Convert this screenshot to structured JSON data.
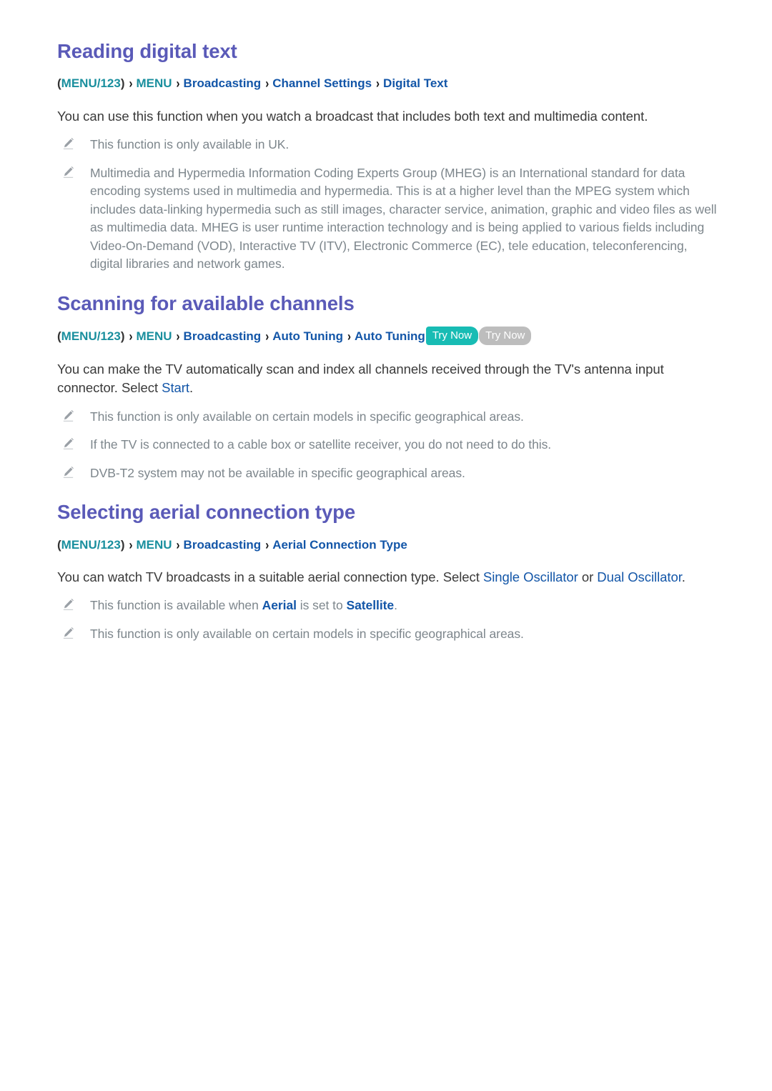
{
  "document": {
    "title": "Samsung TV e-Manual - Broadcasting",
    "colors": {
      "heading": "#5A5AB8",
      "menu_crumb": "#1A8F9E",
      "link_crumb": "#1356A8",
      "body_text": "#3A3A3A",
      "note_text": "#7D868C",
      "trynow_active": "#18BCB4",
      "trynow_inactive": "#BDBDBD"
    }
  },
  "sections": [
    {
      "id": "reading-digital-text",
      "heading": "Reading digital text",
      "breadcrumb": {
        "open_paren": "(",
        "menu123": "MENU/123",
        "close_paren": ")",
        "menu": "MENU",
        "separator": "›",
        "items": [
          "Broadcasting",
          "Channel Settings",
          "Digital Text"
        ],
        "try_now_labels": []
      },
      "body": {
        "text_full": "You can use this function when you watch a broadcast that includes both text and multimedia content."
      },
      "notes": [
        {
          "icon": "pencil-icon",
          "segments": [
            {
              "type": "text",
              "value": "This function is only available in UK."
            }
          ]
        },
        {
          "icon": "pencil-icon",
          "segments": [
            {
              "type": "text",
              "value": "Multimedia and Hypermedia Information Coding Experts Group (MHEG) is an International standard for data encoding systems used in multimedia and hypermedia. This is at a higher level than the MPEG system which includes data-linking hypermedia such as still images, character service, animation, graphic and video files as well as multimedia data. MHEG is user runtime interaction technology and is being applied to various fields including Video-On-Demand (VOD), Interactive TV (ITV), Electronic Commerce (EC), tele education, teleconferencing, digital libraries and network games."
            }
          ]
        }
      ]
    },
    {
      "id": "scanning-for-available-channels",
      "heading": "Scanning for available channels",
      "breadcrumb": {
        "open_paren": "(",
        "menu123": "MENU/123",
        "close_paren": ")",
        "menu": "MENU",
        "separator": "›",
        "items": [
          "Broadcasting",
          "Auto Tuning",
          "Auto Tuning"
        ],
        "try_now_labels": [
          "Try Now",
          "Try Now"
        ]
      },
      "body": {
        "lead": "You can make the TV automatically scan and index all channels received through the TV's antenna input connector. Select ",
        "highlight": "Start",
        "tail": "."
      },
      "notes": [
        {
          "icon": "pencil-icon",
          "segments": [
            {
              "type": "text",
              "value": "This function is only available on certain models in specific geographical areas."
            }
          ]
        },
        {
          "icon": "pencil-icon",
          "segments": [
            {
              "type": "text",
              "value": "If the TV is connected to a cable box or satellite receiver, you do not need to do this."
            }
          ]
        },
        {
          "icon": "pencil-icon",
          "segments": [
            {
              "type": "text",
              "value": "DVB-T2 system may not be available in specific geographical areas."
            }
          ]
        }
      ]
    },
    {
      "id": "selecting-aerial-connection-type",
      "heading": "Selecting aerial connection type",
      "breadcrumb": {
        "open_paren": "(",
        "menu123": "MENU/123",
        "close_paren": ")",
        "menu": "MENU",
        "separator": "›",
        "items": [
          "Broadcasting",
          "Aerial Connection Type"
        ],
        "try_now_labels": []
      },
      "body": {
        "lead": "You can watch TV broadcasts in a suitable aerial connection type. Select ",
        "highlight_1": "Single Oscillator",
        "mid": " or ",
        "highlight_2": "Dual Oscillator",
        "tail": "."
      },
      "notes": [
        {
          "icon": "pencil-icon",
          "segments": [
            {
              "type": "text",
              "value": "This function is available when "
            },
            {
              "type": "bold-link",
              "value": "Aerial"
            },
            {
              "type": "text",
              "value": " is set to "
            },
            {
              "type": "bold-link",
              "value": "Satellite"
            },
            {
              "type": "text",
              "value": "."
            }
          ]
        },
        {
          "icon": "pencil-icon",
          "segments": [
            {
              "type": "text",
              "value": "This function is only available on certain models in specific geographical areas."
            }
          ]
        }
      ]
    }
  ]
}
